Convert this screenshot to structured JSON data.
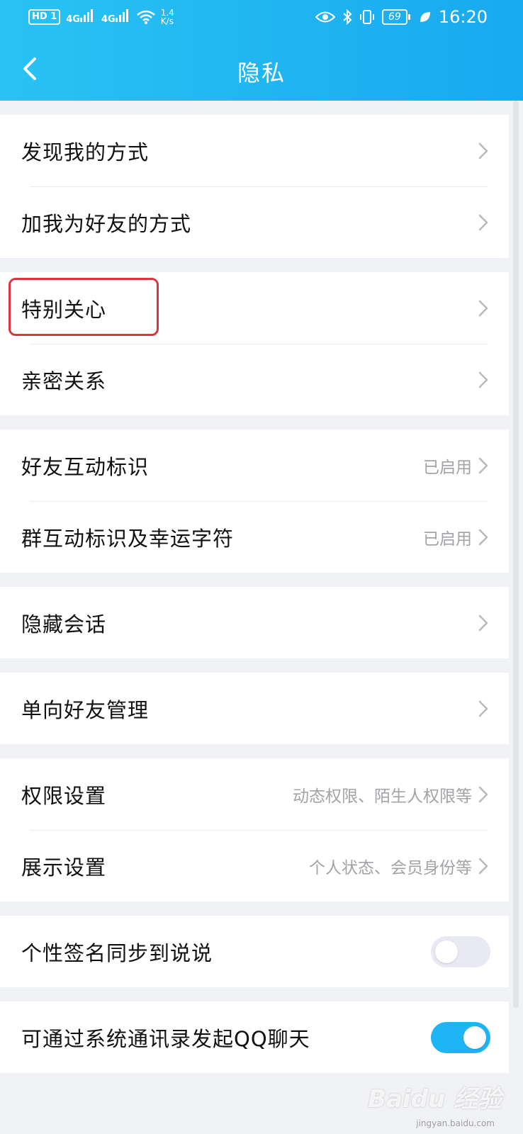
{
  "status_bar": {
    "hd_label": "HD",
    "sim_label": "1",
    "signal1_label": "4G",
    "signal2_label": "4G",
    "net_speed_value": "1.4",
    "net_speed_unit": "K/s",
    "battery_level": "69",
    "time": "16:20"
  },
  "header": {
    "title": "隐私"
  },
  "groups": [
    {
      "items": [
        {
          "label": "发现我的方式",
          "value": ""
        },
        {
          "label": "加我为好友的方式",
          "value": ""
        }
      ]
    },
    {
      "items": [
        {
          "label": "特别关心",
          "value": ""
        },
        {
          "label": "亲密关系",
          "value": ""
        }
      ]
    },
    {
      "items": [
        {
          "label": "好友互动标识",
          "value": "已启用"
        },
        {
          "label": "群互动标识及幸运字符",
          "value": "已启用"
        }
      ]
    },
    {
      "items": [
        {
          "label": "隐藏会话",
          "value": ""
        }
      ]
    },
    {
      "items": [
        {
          "label": "单向好友管理",
          "value": ""
        }
      ]
    },
    {
      "items": [
        {
          "label": "权限设置",
          "value": "动态权限、陌生人权限等"
        },
        {
          "label": "展示设置",
          "value": "个人状态、会员身份等"
        }
      ]
    },
    {
      "items": [
        {
          "label": "个性签名同步到说说",
          "toggle": false
        }
      ]
    },
    {
      "items": [
        {
          "label": "可通过系统通讯录发起QQ聊天",
          "toggle": true
        }
      ]
    }
  ],
  "watermark": {
    "text": "Baidu 经验",
    "sub": "jingyan.baidu.com"
  },
  "colors": {
    "header_start": "#28c3f3",
    "header_end": "#19a9f0",
    "toggle_on": "#1fb4f3",
    "toggle_off": "#e8e9f3",
    "highlight": "#d9363e"
  },
  "icons": {
    "back": "chevron-left-icon",
    "row_arrow": "chevron-right-icon"
  }
}
